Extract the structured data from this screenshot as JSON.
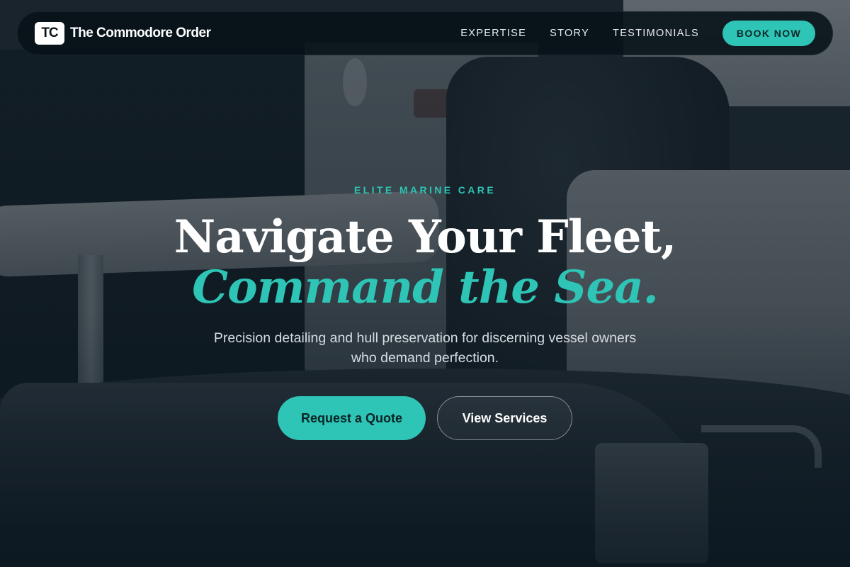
{
  "brand": {
    "logo_text": "TC",
    "name": "The Commodore Order"
  },
  "nav": {
    "links": [
      "EXPERTISE",
      "STORY",
      "TESTIMONIALS"
    ],
    "cta_label": "BOOK NOW"
  },
  "hero": {
    "eyebrow": "ELITE MARINE CARE",
    "headline_line1": "Navigate Your Fleet,",
    "headline_line2": "Command the Sea.",
    "subtext_line1": "Precision detailing and hull preservation for discerning vessel owners",
    "subtext_line2": "who demand perfection.",
    "primary_cta": "Request a Quote",
    "secondary_cta": "View Services"
  },
  "colors": {
    "accent": "#2ec4b6",
    "nav_background": "#071118",
    "text": "#ffffff"
  },
  "background": {
    "icon": "boat-interior-photo"
  }
}
